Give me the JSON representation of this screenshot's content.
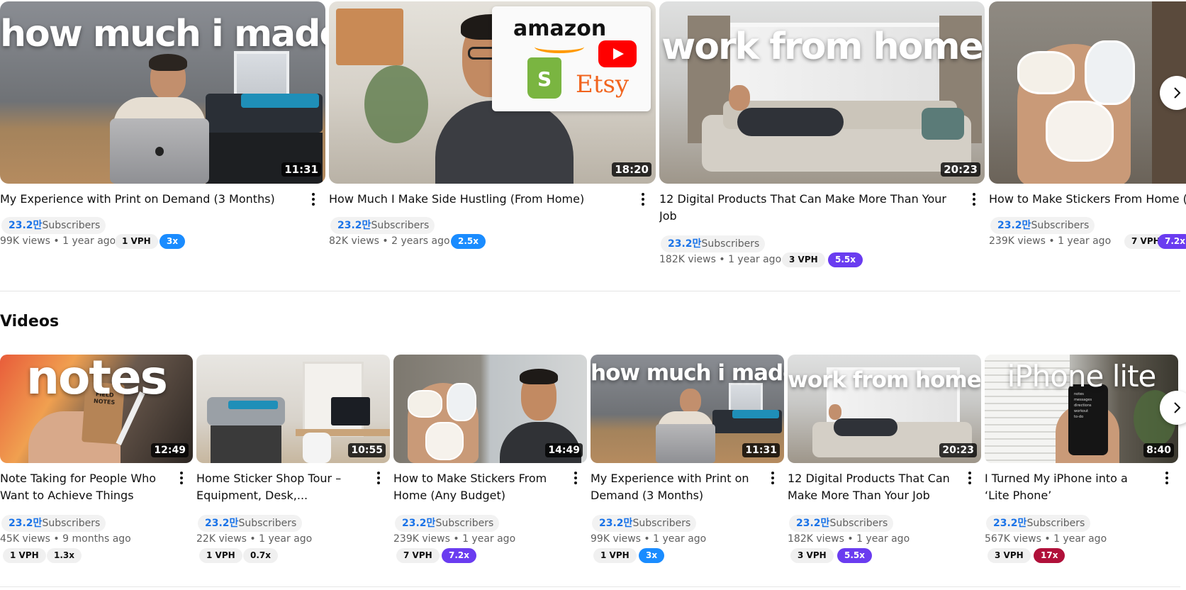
{
  "top_row": [
    {
      "thumb_text": "how much i made",
      "duration": "11:31",
      "title": "My Experience with Print on Demand (3 Months)",
      "subs_count": "23.2만",
      "subs_label": "Subscribers",
      "views": "99K views",
      "age": "1 year ago",
      "vph": "1 VPH",
      "ratio": "3x",
      "ratio_color": "#1a8cff"
    },
    {
      "thumb_text": "amazon",
      "duration": "18:20",
      "title": "How Much I Make Side Hustling (From Home)",
      "subs_count": "23.2만",
      "subs_label": "Subscribers",
      "views": "82K views",
      "age": "2 years ago",
      "vph": "",
      "ratio": "2.5x",
      "ratio_color": "#1a8cff",
      "logo_etsy": "Etsy"
    },
    {
      "thumb_text": "work from home",
      "duration": "20:23",
      "title": "12 Digital Products That Can Make More Than Your Job",
      "subs_count": "23.2만",
      "subs_label": "Subscribers",
      "views": "182K views",
      "age": "1 year ago",
      "vph": "3 VPH",
      "ratio": "5.5x",
      "ratio_color": "#6a3cf0"
    },
    {
      "thumb_text": "",
      "duration": "",
      "title": "How to Make Stickers From Home (Any Budget)",
      "subs_count": "23.2만",
      "subs_label": "Subscribers",
      "views": "239K views",
      "age": "1 year ago",
      "vph": "7 VPH",
      "ratio": "7.2x",
      "ratio_color": "#6a3cf0"
    }
  ],
  "videos_section": {
    "title": "Videos"
  },
  "videos": [
    {
      "thumb_text": "notes",
      "notebook_text": "FIELD NOTES",
      "duration": "12:49",
      "title_line1": "Note Taking for People Who",
      "title_line2": "Want to Achieve Things",
      "subs_count": "23.2만",
      "subs_label": "Subscribers",
      "views": "45K views",
      "age": "9 months ago",
      "vph": "1 VPH",
      "ratio": "1.3x",
      "ratio_color": "#f0f0f0",
      "ratio_text_color": "#0f0f0f"
    },
    {
      "thumb_text": "",
      "duration": "10:55",
      "title_line1": "Home Sticker Shop Tour –",
      "title_line2": "Equipment, Desk,...",
      "subs_count": "23.2만",
      "subs_label": "Subscribers",
      "views": "22K views",
      "age": "1 year ago",
      "vph": "1 VPH",
      "ratio": "0.7x",
      "ratio_color": "#f0f0f0",
      "ratio_text_color": "#0f0f0f"
    },
    {
      "thumb_text": "",
      "duration": "14:49",
      "title_line1": "How to Make Stickers From",
      "title_line2": "Home (Any Budget)",
      "subs_count": "23.2만",
      "subs_label": "Subscribers",
      "views": "239K views",
      "age": "1 year ago",
      "vph": "7 VPH",
      "ratio": "7.2x",
      "ratio_color": "#6a3cf0",
      "ratio_text_color": "#ffffff"
    },
    {
      "thumb_text": "how much i made",
      "duration": "11:31",
      "title_line1": "My Experience with Print on",
      "title_line2": "Demand (3 Months)",
      "subs_count": "23.2만",
      "subs_label": "Subscribers",
      "views": "99K views",
      "age": "1 year ago",
      "vph": "1 VPH",
      "ratio": "3x",
      "ratio_color": "#1a8cff",
      "ratio_text_color": "#ffffff"
    },
    {
      "thumb_text": "work from home",
      "duration": "20:23",
      "title_line1": "12 Digital Products That Can",
      "title_line2": "Make More Than Your Job",
      "subs_count": "23.2만",
      "subs_label": "Subscribers",
      "views": "182K views",
      "age": "1 year ago",
      "vph": "3 VPH",
      "ratio": "5.5x",
      "ratio_color": "#6a3cf0",
      "ratio_text_color": "#ffffff"
    },
    {
      "thumb_text": "iPhone lite",
      "duration": "8:40",
      "title_line1": "I Turned My iPhone into a",
      "title_line2": "‘Lite Phone’",
      "subs_count": "23.2만",
      "subs_label": "Subscribers",
      "views": "567K views",
      "age": "1 year ago",
      "vph": "3 VPH",
      "ratio": "17x",
      "ratio_color": "#b0103a",
      "ratio_text_color": "#ffffff"
    }
  ],
  "phone_menu": [
    "notes",
    "messages",
    "directions",
    "workout",
    "to-do"
  ]
}
